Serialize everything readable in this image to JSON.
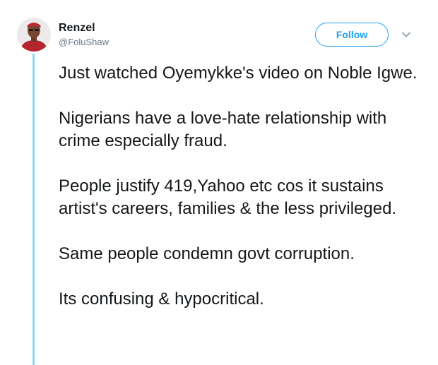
{
  "user": {
    "display_name": "Renzel",
    "handle": "@FoluShaw",
    "avatar_icon": "profile-photo-avatar"
  },
  "actions": {
    "follow_label": "Follow",
    "more_icon": "chevron-down-icon"
  },
  "colors": {
    "accent": "#1da1f2",
    "thread_line": "#87d8ec",
    "text": "#14171a",
    "muted": "#657786"
  },
  "tweet": {
    "paragraphs": [
      "Just watched Oyemykke's video on Noble Igwe.",
      "Nigerians have a love-hate relationship with crime especially fraud.",
      "People justify 419,Yahoo etc cos it sustains artist's careers, families & the less privileged.",
      "Same people condemn govt corruption.",
      "Its confusing & hypocritical."
    ]
  }
}
